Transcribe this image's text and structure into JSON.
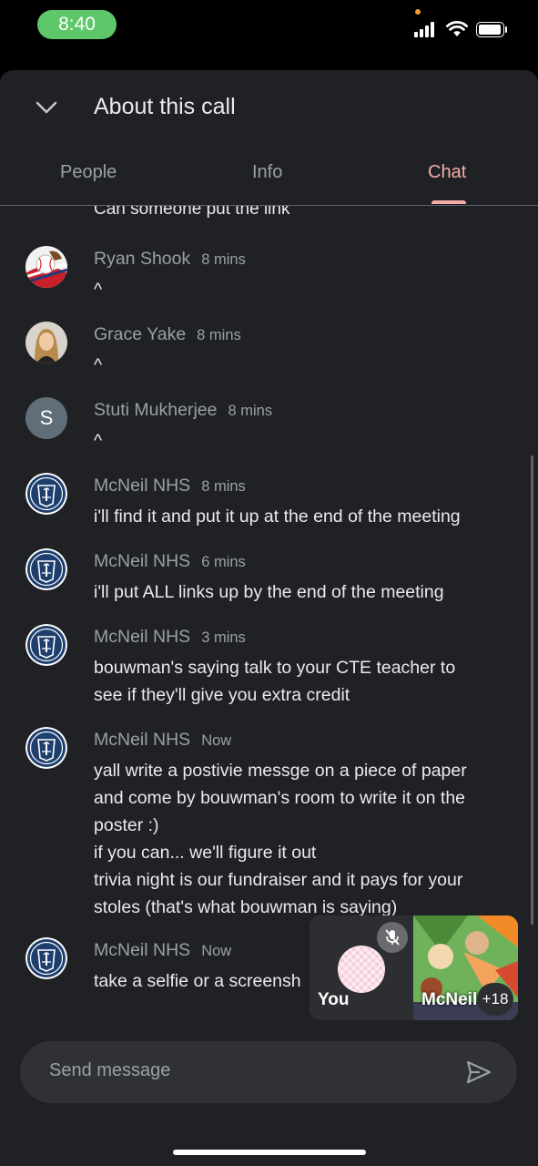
{
  "status_bar": {
    "time": "8:40"
  },
  "sheet": {
    "title": "About this call",
    "tabs": [
      {
        "label": "People",
        "active": false
      },
      {
        "label": "Info",
        "active": false
      },
      {
        "label": "Chat",
        "active": true
      }
    ]
  },
  "chat": {
    "cut_off_text": "Can someone put the link",
    "messages": [
      {
        "sender": "Ryan Shook",
        "time": "8 mins",
        "avatar": "baseball-photo",
        "lines": [
          "^"
        ]
      },
      {
        "sender": "Grace Yake",
        "time": "8 mins",
        "avatar": "person-photo",
        "lines": [
          "^"
        ]
      },
      {
        "sender": "Stuti Mukherjee",
        "time": "8 mins",
        "avatar": "S",
        "lines": [
          "^"
        ]
      },
      {
        "sender": "McNeil NHS",
        "time": "8 mins",
        "avatar": "nhs-logo",
        "lines": [
          "i'll find it and put it up at the end of the meeting"
        ]
      },
      {
        "sender": "McNeil NHS",
        "time": "6 mins",
        "avatar": "nhs-logo",
        "lines": [
          "i'll put ALL links up by the end of the meeting"
        ]
      },
      {
        "sender": "McNeil NHS",
        "time": "3 mins",
        "avatar": "nhs-logo",
        "lines": [
          "bouwman's saying talk to your CTE teacher to",
          "see if they'll give you extra credit"
        ]
      },
      {
        "sender": "McNeil NHS",
        "time": "Now",
        "avatar": "nhs-logo",
        "lines": [
          "yall write a postivie messge on a piece of paper",
          "and come by bouwman's room to write it on the",
          "poster :)",
          "if you can... we'll figure it out",
          "trivia night is our fundraiser and it pays for your",
          "stoles (that's what bouwman is saying)"
        ]
      },
      {
        "sender": "McNeil NHS",
        "time": "Now",
        "avatar": "nhs-logo",
        "lines": [
          "take a selfie or a screensh"
        ]
      }
    ]
  },
  "pip": {
    "self_label": "You",
    "other_label": "McNeil",
    "participant_count": "+18"
  },
  "composer": {
    "placeholder": "Send message"
  },
  "colors": {
    "accent": "#f6aea9",
    "background": "#202124",
    "time_pill": "#5ec769"
  }
}
